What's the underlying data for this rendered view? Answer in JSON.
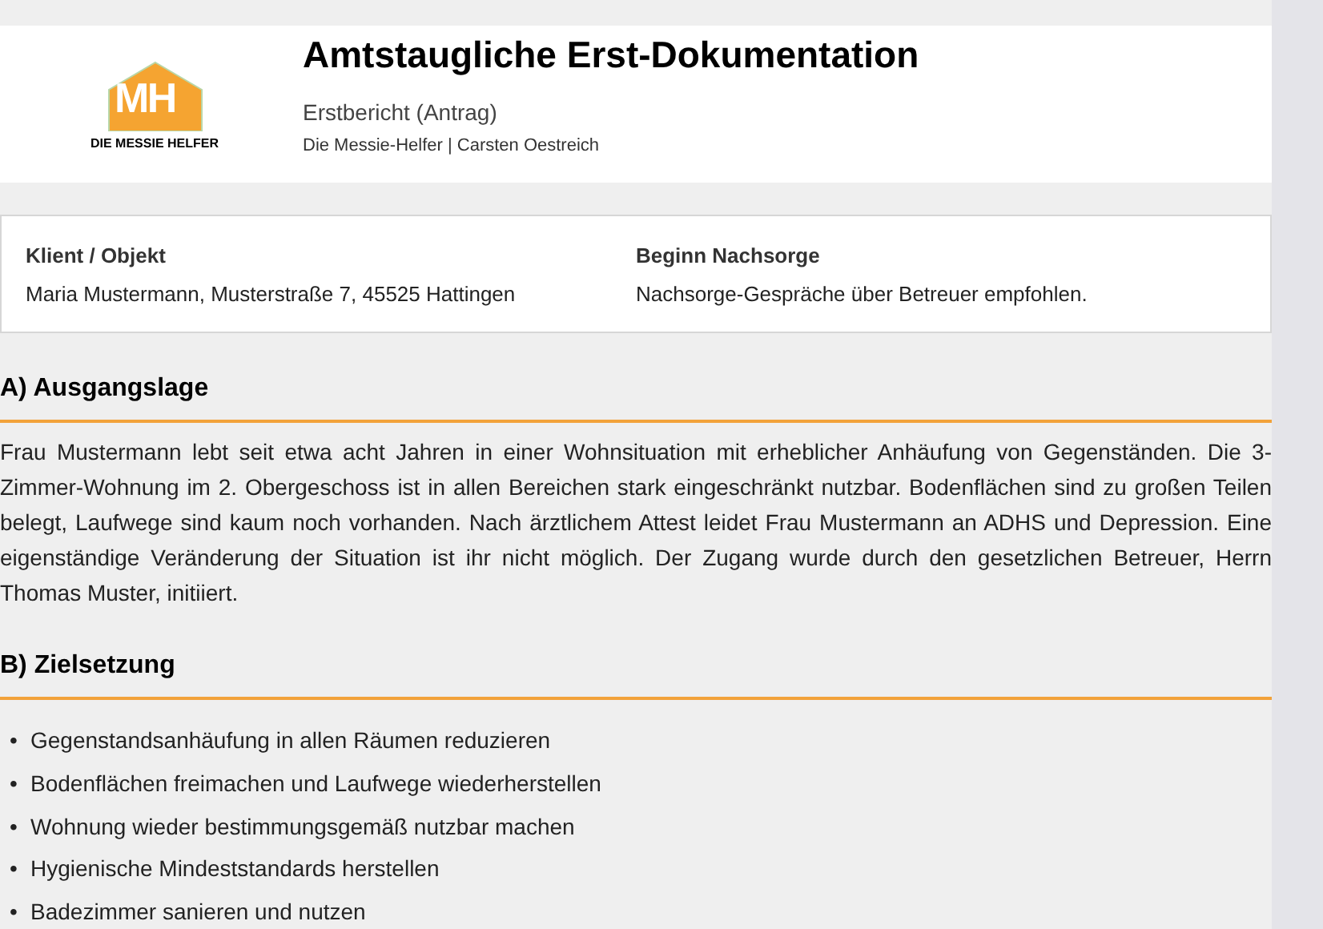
{
  "header": {
    "logo": {
      "initials": "MH",
      "name": "DIE MESSIE HELFER"
    },
    "title": "Amtstaugliche Erst-Dokumentation",
    "subtitle": "Erstbericht (Antrag)",
    "meta": "Die Messie-Helfer | Carsten Oestreich"
  },
  "info": [
    {
      "label": "Klient / Objekt",
      "value": "Maria Mustermann, Musterstraße 7, 45525 Hattingen"
    },
    {
      "label": "Beginn Nachsorge",
      "value": "Nachsorge-Gespräche über Betreuer empfohlen."
    }
  ],
  "sections": [
    {
      "heading": "A) Ausgangslage",
      "kind": "paragraph",
      "text": "Frau Mustermann lebt seit etwa acht Jahren in einer Wohnsituation mit erheblicher Anhäufung von Gegenständen. Die 3-Zimmer-Wohnung im 2. Obergeschoss ist in allen Bereichen stark eingeschränkt nutzbar. Bodenflächen sind zu großen Teilen belegt, Laufwege sind kaum noch vorhanden. Nach ärztlichem Attest leidet Frau Mustermann an ADHS und Depression. Eine eigenständige Veränderung der Situation ist ihr nicht möglich. Der Zugang wurde durch den gesetzlichen Betreuer, Herrn Thomas Muster, initiiert."
    },
    {
      "heading": "B) Zielsetzung",
      "kind": "list",
      "marker": "•",
      "items": [
        "Gegenstandsanhäufung in allen Räumen reduzieren",
        "Bodenflächen freimachen und Laufwege wiederherstellen",
        "Wohnung wieder bestimmungsgemäß nutzbar machen",
        "Hygienische Mindeststandards herstellen",
        "Badezimmer sanieren und nutzen"
      ]
    }
  ]
}
